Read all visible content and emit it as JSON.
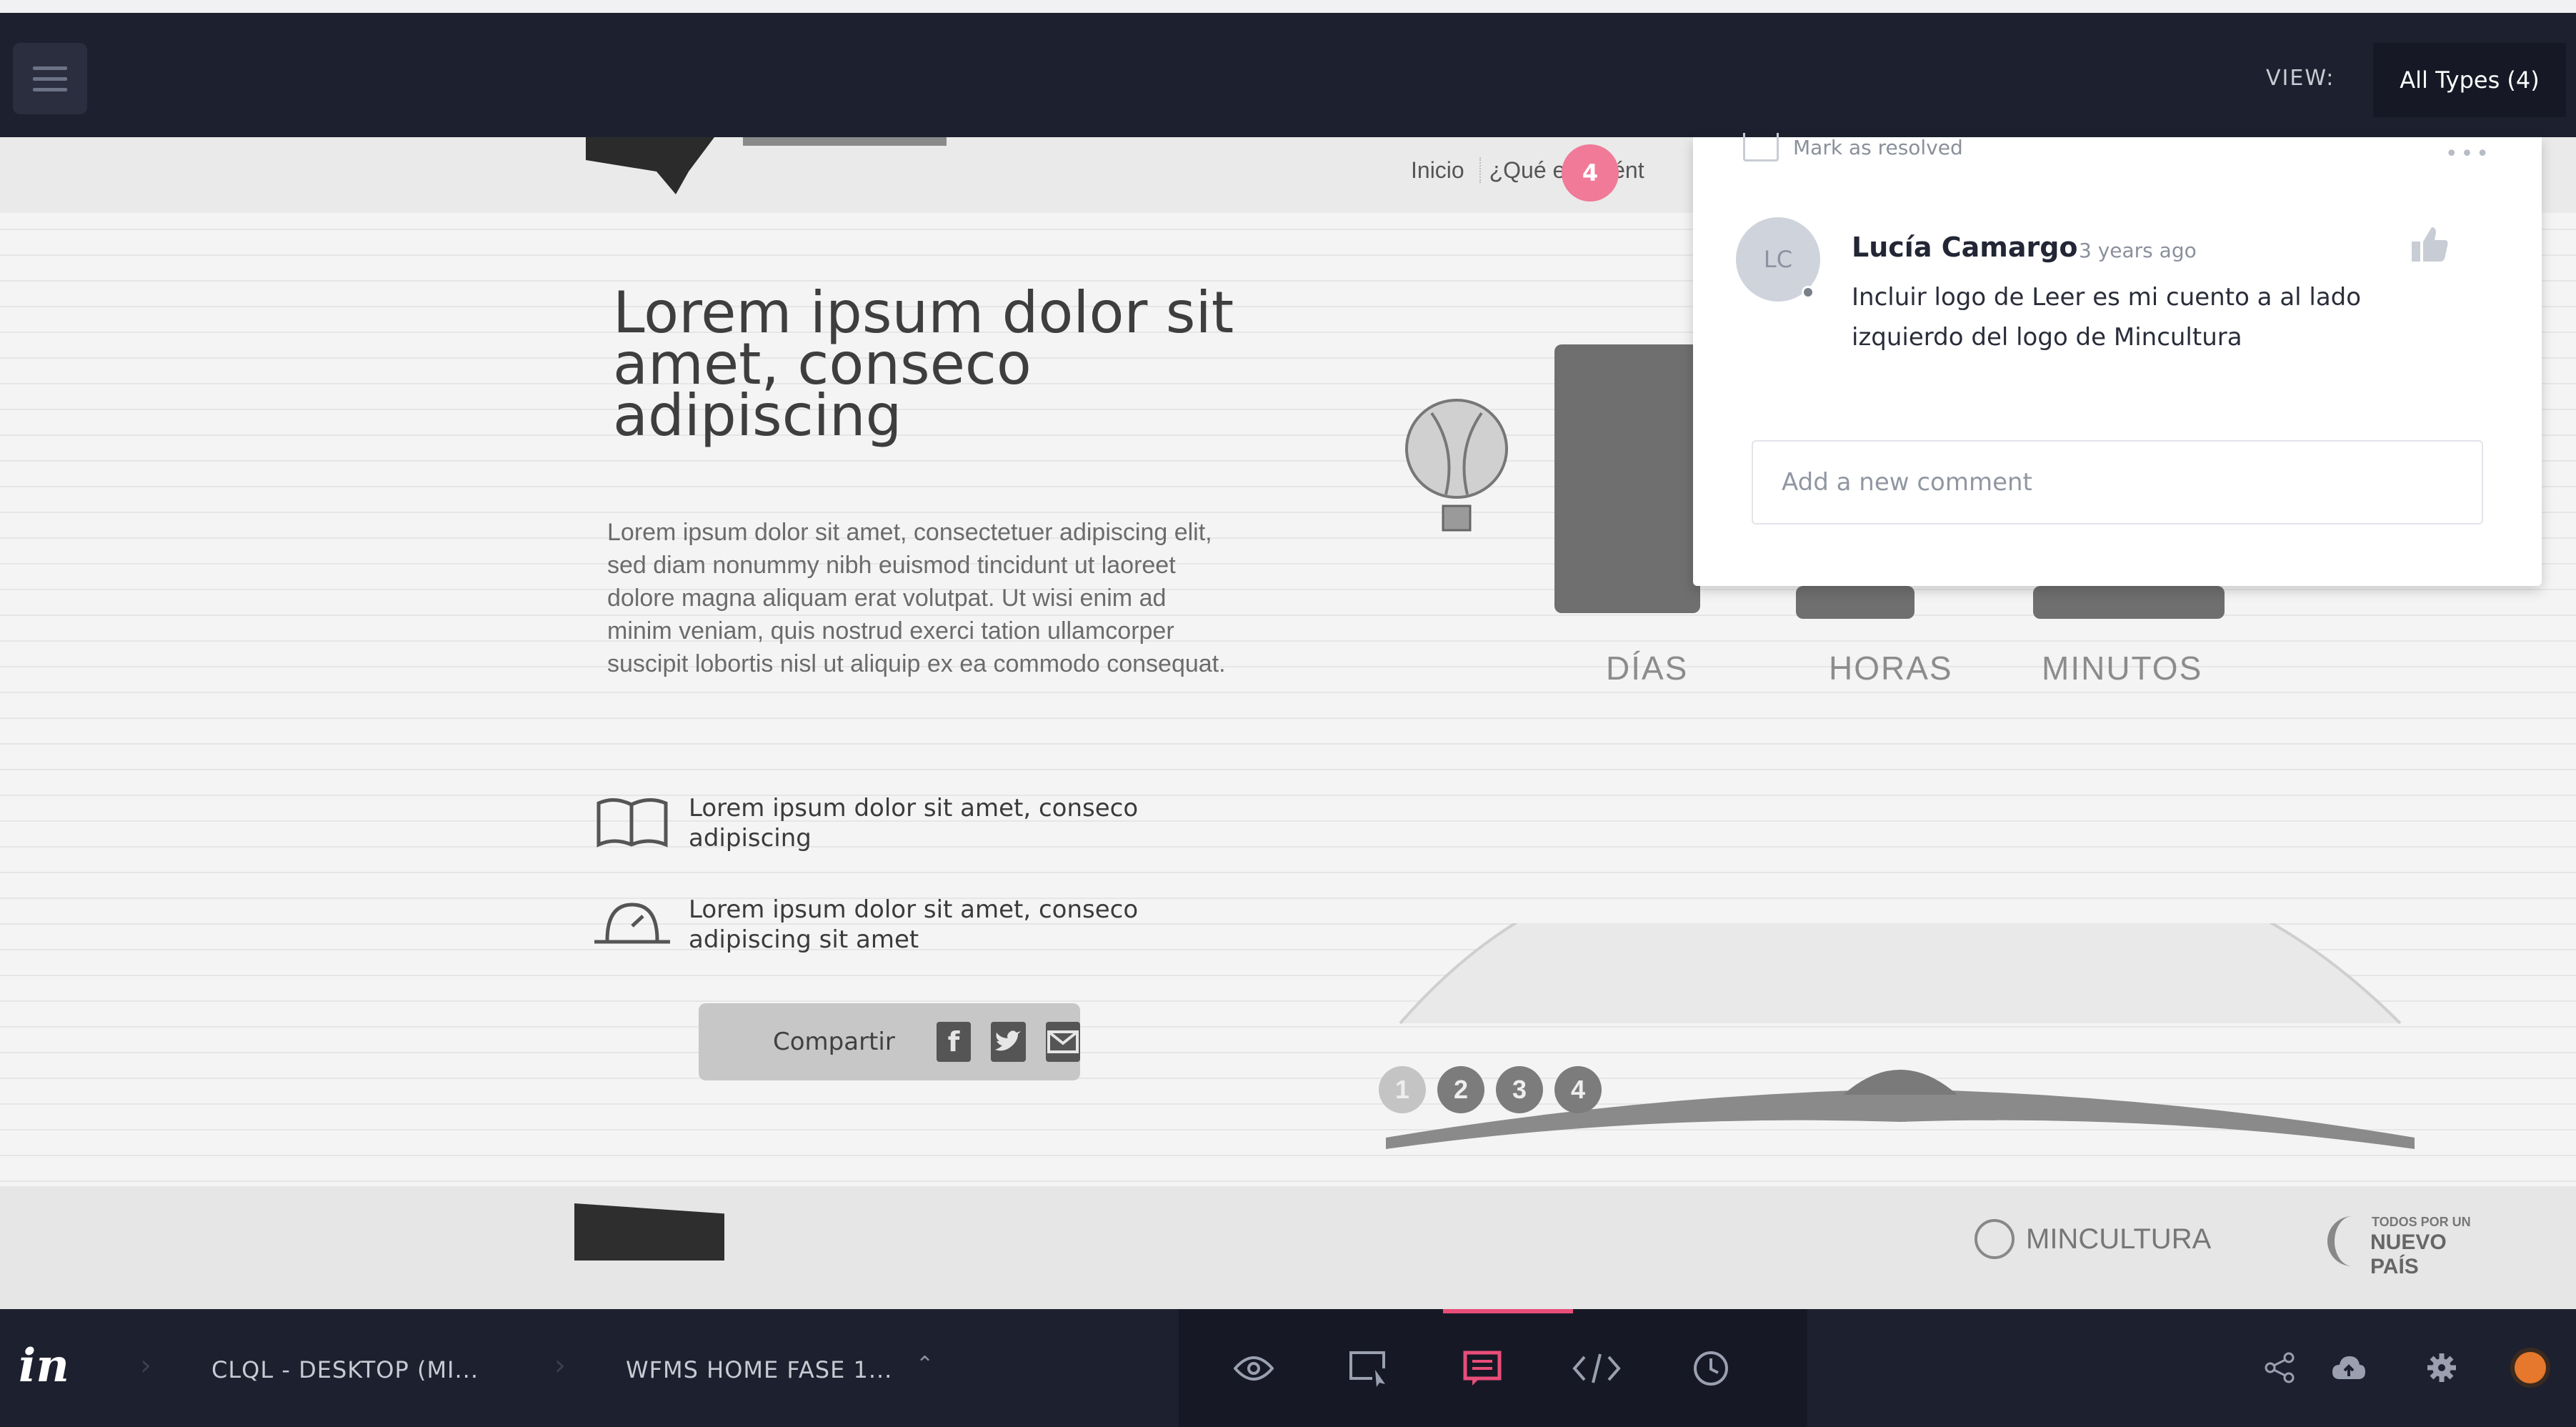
{
  "topbar": {
    "menu_icon": "hamburger-icon",
    "view_label": "VIEW:",
    "view_select": "All Types (4)"
  },
  "prototype": {
    "nav": {
      "item1": "Inicio",
      "item2": "¿Qué es Cuént"
    },
    "comment_pin": "4",
    "hero_title": "Lorem ipsum dolor sit amet, conseco adipiscing",
    "hero_text": "Lorem ipsum dolor sit amet, consectetuer adipiscing elit, sed diam nonummy nibh euismod tincidunt ut laoreet dolore magna aliquam erat volutpat. Ut wisi enim ad minim veniam, quis nostrud exerci tation ullamcorper suscipit lobortis nisl ut aliquip ex ea commodo consequat.",
    "features": [
      {
        "icon": "open-book-icon",
        "text": "Lorem ipsum dolor sit amet, conseco adipiscing"
      },
      {
        "icon": "clock-icon",
        "text": "Lorem ipsum dolor sit amet, conseco adipiscing sit amet"
      }
    ],
    "share": {
      "label": "Compartir",
      "icons": [
        "facebook-icon",
        "twitter-icon",
        "mail-icon"
      ],
      "facebook_glyph": "f"
    },
    "counter_labels": {
      "days": "DÍAS",
      "hours": "HORAS",
      "minutes": "MINUTOS"
    },
    "pager": [
      "1",
      "2",
      "3",
      "4"
    ],
    "footer": {
      "mincultura": "MINCULTURA",
      "todos_line1": "TODOS POR UN",
      "todos_line2": "NUEVO PAÍS"
    }
  },
  "comment": {
    "mark_resolved": "Mark as resolved",
    "more": "•••",
    "avatar_initials": "LC",
    "author": "Lucía Camargo",
    "time": "3 years ago",
    "text": "Incluir logo de Leer es mi cuento a al lado izquierdo del logo de Mincultura",
    "input_placeholder": "Add a new comment"
  },
  "bottombar": {
    "logo": "in",
    "breadcrumb": [
      "CLQL - DESKTOP (MI...",
      "WFMS HOME FASE 1..."
    ],
    "caret": "⌃",
    "tools": [
      "preview-mode",
      "build-mode",
      "comment-mode",
      "inspect-mode",
      "history-mode"
    ],
    "active_tool": "comment-mode",
    "right_icons": [
      "share-icon",
      "cloud-upload-icon",
      "settings-icon",
      "user-status-icon"
    ],
    "accent_color": "#e94d7a",
    "status_color": "#e5782c"
  }
}
